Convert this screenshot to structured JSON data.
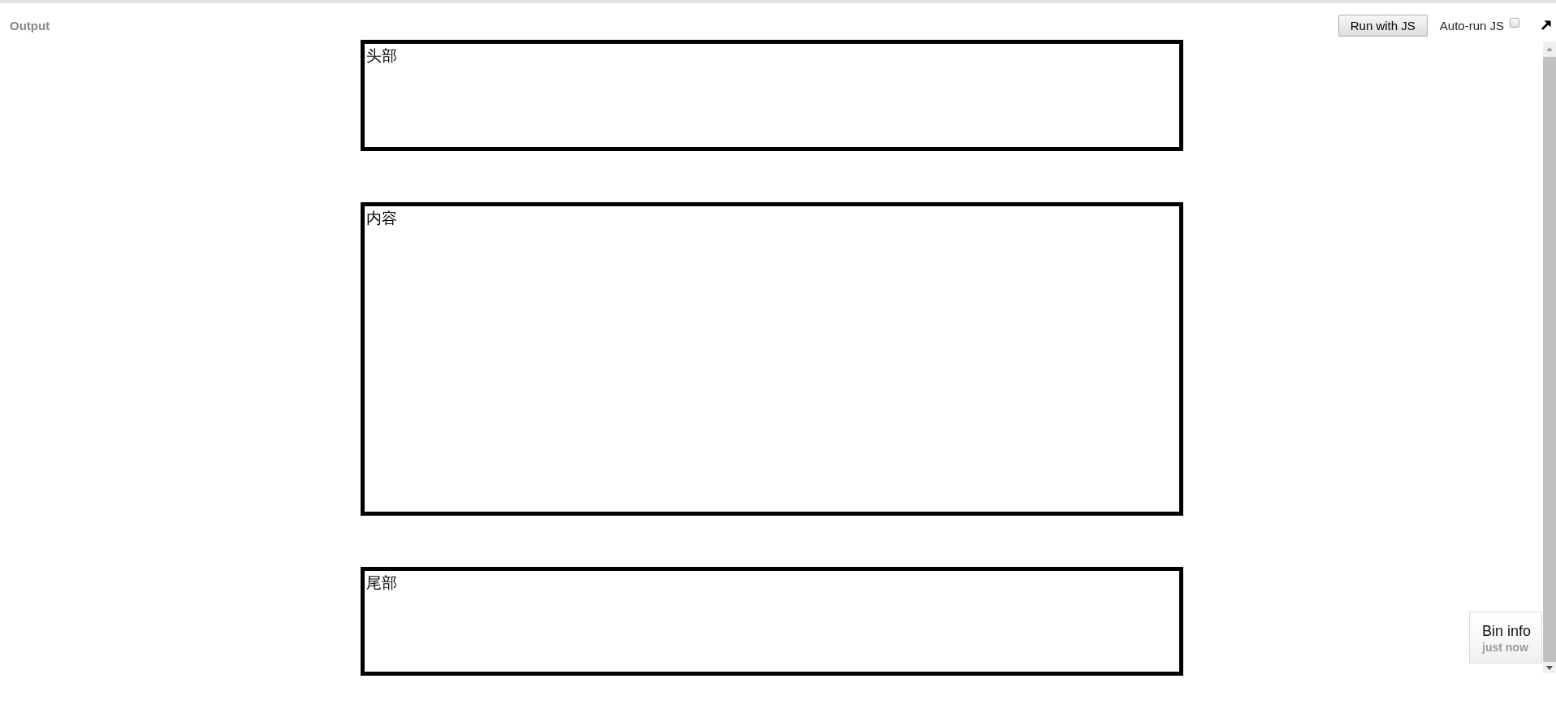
{
  "header": {
    "title": "Output"
  },
  "toolbar": {
    "run_button": "Run with JS",
    "auto_run": {
      "label": "Auto-run JS",
      "checked": false
    }
  },
  "panels": [
    {
      "label": "头部"
    },
    {
      "label": "内容"
    },
    {
      "label": "尾部"
    }
  ],
  "bin_info": {
    "title": "Bin info",
    "time": "just now"
  }
}
